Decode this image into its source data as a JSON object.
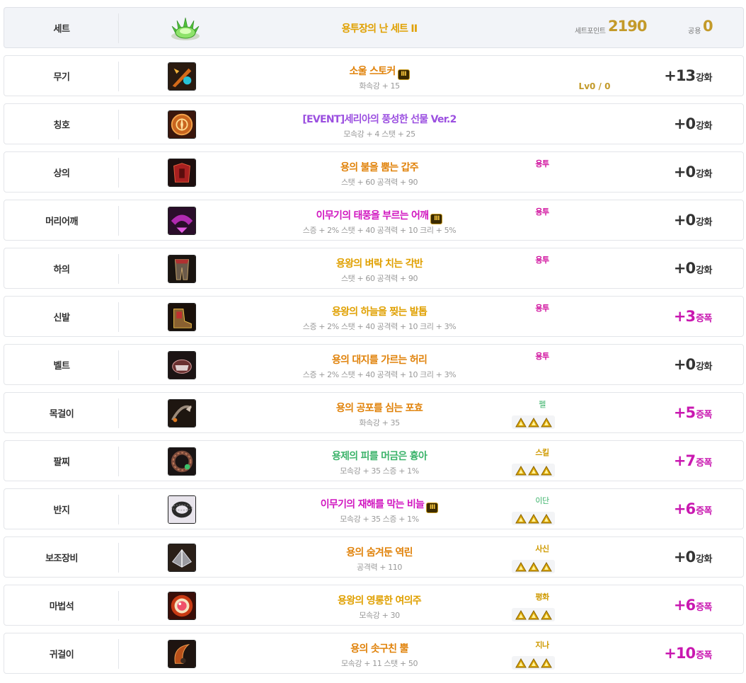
{
  "header": {
    "slot": "세트",
    "set_name": "용투장의 난 세트 II",
    "point_label": "세트포인트",
    "point_value": "2190",
    "common_label": "공용",
    "common_value": "0"
  },
  "colors": {
    "epic_orange": "#e0820a",
    "legend_gold": "#e0a000",
    "unique_pink": "#d117c0",
    "event_purple": "#9b4fe0",
    "rare_green": "#3bb36a",
    "amp_magenta": "#c918b0"
  },
  "rows": [
    {
      "slot": "무기",
      "name": "소울 스토커",
      "mark": "Ⅲ",
      "stats": "화속강 + 15",
      "tag": "",
      "emblems": false,
      "lv": "Lv0 / 0",
      "enh_val": "+13",
      "enh_unit": "강화",
      "amp": false,
      "name_color": "#e0820a",
      "tag_kind": "",
      "icon": "weapon-icon"
    },
    {
      "slot": "칭호",
      "name": "[EVENT]세리아의 풍성한 선물 Ver.2",
      "mark": "",
      "stats": "모속강 + 4 스탯 + 25",
      "tag": "",
      "emblems": false,
      "lv": "",
      "enh_val": "+0",
      "enh_unit": "강화",
      "amp": false,
      "name_color": "#9b4fe0",
      "tag_kind": "",
      "icon": "title-icon"
    },
    {
      "slot": "상의",
      "name": "용의 불을 뿜는 갑주",
      "mark": "",
      "stats": "스탯 + 60 공격력 + 90",
      "tag": "용투",
      "emblems": false,
      "lv": "",
      "enh_val": "+0",
      "enh_unit": "강화",
      "amp": false,
      "name_color": "#e0820a",
      "tag_kind": "ytu",
      "icon": "top-armor-icon"
    },
    {
      "slot": "머리어깨",
      "name": "이무기의 태풍을 부르는 어깨",
      "mark": "Ⅲ",
      "stats": "스증 + 2% 스탯 + 40 공격력 + 10 크리 + 5%",
      "tag": "용투",
      "emblems": false,
      "lv": "",
      "enh_val": "+0",
      "enh_unit": "강화",
      "amp": false,
      "name_color": "#d117c0",
      "tag_kind": "ytu",
      "icon": "shoulder-icon"
    },
    {
      "slot": "하의",
      "name": "용왕의 벼락 치는 각반",
      "mark": "",
      "stats": "스탯 + 60 공격력 + 90",
      "tag": "용투",
      "emblems": false,
      "lv": "",
      "enh_val": "+0",
      "enh_unit": "강화",
      "amp": false,
      "name_color": "#e0a000",
      "tag_kind": "ytu",
      "icon": "bottom-armor-icon"
    },
    {
      "slot": "신발",
      "name": "용왕의 하늘을 찢는 발톱",
      "mark": "",
      "stats": "스증 + 2% 스탯 + 40 공격력 + 10 크리 + 3%",
      "tag": "용투",
      "emblems": false,
      "lv": "",
      "enh_val": "+3",
      "enh_unit": "증폭",
      "amp": true,
      "name_color": "#e0a000",
      "tag_kind": "ytu",
      "icon": "shoes-icon"
    },
    {
      "slot": "벨트",
      "name": "용의 대지를 가르는 허리",
      "mark": "",
      "stats": "스증 + 2% 스탯 + 40 공격력 + 10 크리 + 3%",
      "tag": "용투",
      "emblems": false,
      "lv": "",
      "enh_val": "+0",
      "enh_unit": "강화",
      "amp": false,
      "name_color": "#e0820a",
      "tag_kind": "ytu",
      "icon": "belt-icon"
    },
    {
      "slot": "목걸이",
      "name": "용의 공포를 심는 포효",
      "mark": "",
      "stats": "화속강 + 35",
      "tag": "펠",
      "emblems": true,
      "lv": "",
      "enh_val": "+5",
      "enh_unit": "증폭",
      "amp": true,
      "name_color": "#e0820a",
      "tag_kind": "card",
      "icon": "necklace-icon"
    },
    {
      "slot": "팔찌",
      "name": "용제의 피를 머금은 흉아",
      "mark": "",
      "stats": "모속강 + 35 스증 + 1%",
      "tag": "스킬",
      "emblems": true,
      "lv": "",
      "enh_val": "+7",
      "enh_unit": "증폭",
      "amp": true,
      "name_color": "#3bb36a",
      "tag_kind": "card2",
      "icon": "bracelet-icon"
    },
    {
      "slot": "반지",
      "name": "이무기의 재해를 막는 비늘",
      "mark": "Ⅲ",
      "stats": "모속강 + 35 스증 + 1%",
      "tag": "이단",
      "emblems": true,
      "lv": "",
      "enh_val": "+6",
      "enh_unit": "증폭",
      "amp": true,
      "name_color": "#d117c0",
      "tag_kind": "card",
      "icon": "ring-icon"
    },
    {
      "slot": "보조장비",
      "name": "용의 숨겨둔 역린",
      "mark": "",
      "stats": "공격력 + 110",
      "tag": "사신",
      "emblems": true,
      "lv": "",
      "enh_val": "+0",
      "enh_unit": "강화",
      "amp": false,
      "name_color": "#e0820a",
      "tag_kind": "card2",
      "icon": "sub-equipment-icon"
    },
    {
      "slot": "마법석",
      "name": "용왕의 영롱한 여의주",
      "mark": "",
      "stats": "모속강 + 30",
      "tag": "평화",
      "emblems": true,
      "lv": "",
      "enh_val": "+6",
      "enh_unit": "증폭",
      "amp": true,
      "name_color": "#e0a000",
      "tag_kind": "card2",
      "icon": "magic-stone-icon"
    },
    {
      "slot": "귀걸이",
      "name": "용의 솟구친 뿔",
      "mark": "",
      "stats": "모속강 + 11 스탯 + 50",
      "tag": "지나",
      "emblems": true,
      "lv": "",
      "enh_val": "+10",
      "enh_unit": "증폭",
      "amp": true,
      "name_color": "#e0820a",
      "tag_kind": "card2",
      "icon": "earring-icon"
    }
  ]
}
